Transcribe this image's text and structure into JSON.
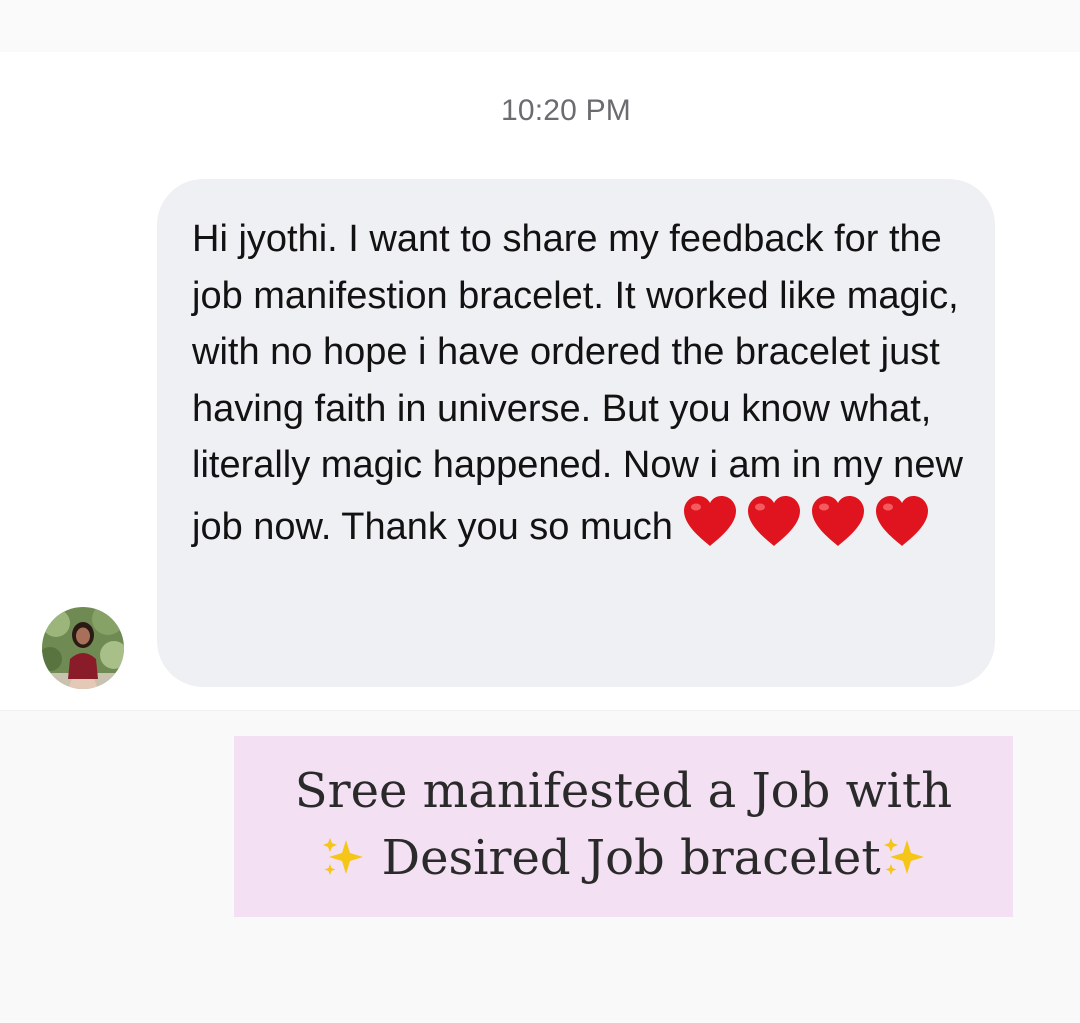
{
  "conversation": {
    "timestamp": "10:20 PM",
    "message": {
      "text": "Hi jyothi. I want to share my feedback for the job manifestion bracelet. It worked like magic, with no hope i have ordered the bracelet just having faith in universe. But you know what, literally magic happened. Now i am in my new job now. Thank you so much",
      "emoji": [
        "red-heart",
        "red-heart",
        "red-heart",
        "red-heart"
      ]
    }
  },
  "caption": {
    "line1": "Sree manifested a Job with",
    "line2": "Desired Job bracelet",
    "sparkle_icon": "sparkles"
  },
  "colors": {
    "bubble": "#eff0f3",
    "caption_bg": "#f3e0f3",
    "heart": "#e0141e",
    "sparkle": "#f5c518"
  }
}
